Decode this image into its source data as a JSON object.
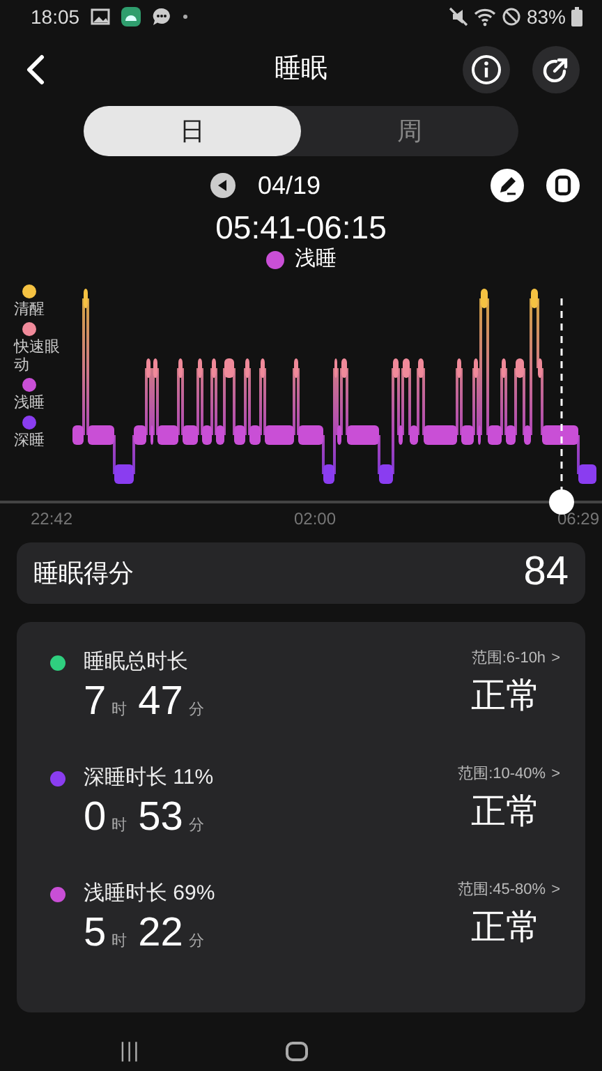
{
  "status_bar": {
    "time": "18:05",
    "battery": "83%"
  },
  "header": {
    "title": "睡眠"
  },
  "tabs": [
    {
      "label": "日",
      "selected": true
    },
    {
      "label": "周",
      "selected": false
    }
  ],
  "date_nav": {
    "date": "04/19"
  },
  "selection": {
    "time_range": "05:41-06:15",
    "stages": [
      {
        "label": "浅睡",
        "color": "#c94fd6"
      }
    ]
  },
  "chart": {
    "legend": [
      {
        "label": "清醒",
        "color": "#f5c242"
      },
      {
        "label": "快速眼动",
        "color": "#f08a9a"
      },
      {
        "label": "浅睡",
        "color": "#c94fd6"
      },
      {
        "label": "深睡",
        "color": "#8a3df0"
      }
    ],
    "axis_labels": [
      "22:42",
      "02:00",
      "06:29"
    ]
  },
  "score": {
    "label": "睡眠得分",
    "value": "84"
  },
  "stats": [
    {
      "title": "睡眠总时长",
      "color": "#2fcf7f",
      "hours": "7",
      "hour_unit": "时",
      "minutes": "47",
      "minute_unit": "分",
      "range": "范围:6-10h",
      "chevron": ">",
      "status": "正常"
    },
    {
      "title": "深睡时长 11%",
      "color": "#8a3df0",
      "hours": "0",
      "hour_unit": "时",
      "minutes": "53",
      "minute_unit": "分",
      "range": "范围:10-40%",
      "chevron": ">",
      "status": "正常"
    },
    {
      "title": "浅睡时长 69%",
      "color": "#c94fd6",
      "hours": "5",
      "hour_unit": "时",
      "minutes": "22",
      "minute_unit": "分",
      "range": "范围:45-80%",
      "chevron": ">",
      "status": "正常"
    }
  ],
  "nav_bar": {
    "recents": "|||"
  }
}
